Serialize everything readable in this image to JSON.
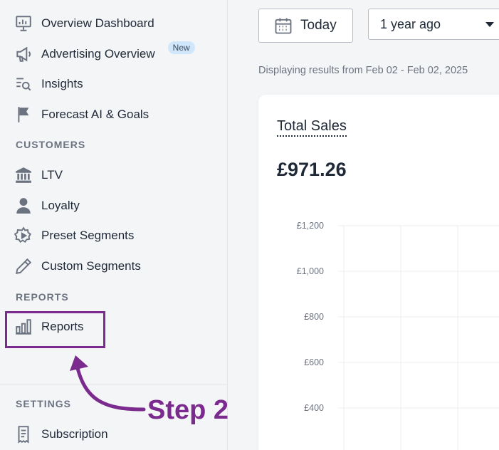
{
  "sidebar": {
    "items": [
      {
        "label": "Overview Dashboard",
        "icon": "presentation-chart-icon"
      },
      {
        "label": "Advertising Overview",
        "icon": "megaphone-icon",
        "badge": "New"
      },
      {
        "label": "Insights",
        "icon": "search-lines-icon"
      },
      {
        "label": "Forecast AI & Goals",
        "icon": "flag-icon"
      }
    ],
    "customers_label": "CUSTOMERS",
    "customers": [
      {
        "label": "LTV",
        "icon": "bank-icon"
      },
      {
        "label": "Loyalty",
        "icon": "user-icon"
      },
      {
        "label": "Preset Segments",
        "icon": "gear-play-icon"
      },
      {
        "label": "Custom Segments",
        "icon": "pencil-icon"
      }
    ],
    "reports_label": "REPORTS",
    "reports": [
      {
        "label": "Reports",
        "icon": "bar-chart-icon"
      }
    ],
    "settings_label": "SETTINGS",
    "settings": [
      {
        "label": "Subscription",
        "icon": "receipt-icon"
      }
    ]
  },
  "annotation": {
    "text": "Step 2",
    "color": "#7b2a8e"
  },
  "toolbar": {
    "today_label": "Today",
    "range_value": "1 year ago"
  },
  "display_text": "Displaying results from Feb 02 - Feb 02, 2025",
  "card": {
    "title": "Total Sales",
    "value": "£971.26"
  },
  "chart_data": {
    "type": "line",
    "title": "",
    "yticks": [
      "£1,200",
      "£1,000",
      "£800",
      "£600",
      "£400"
    ],
    "ylim": [
      400,
      1200
    ],
    "grid": true,
    "series": []
  }
}
